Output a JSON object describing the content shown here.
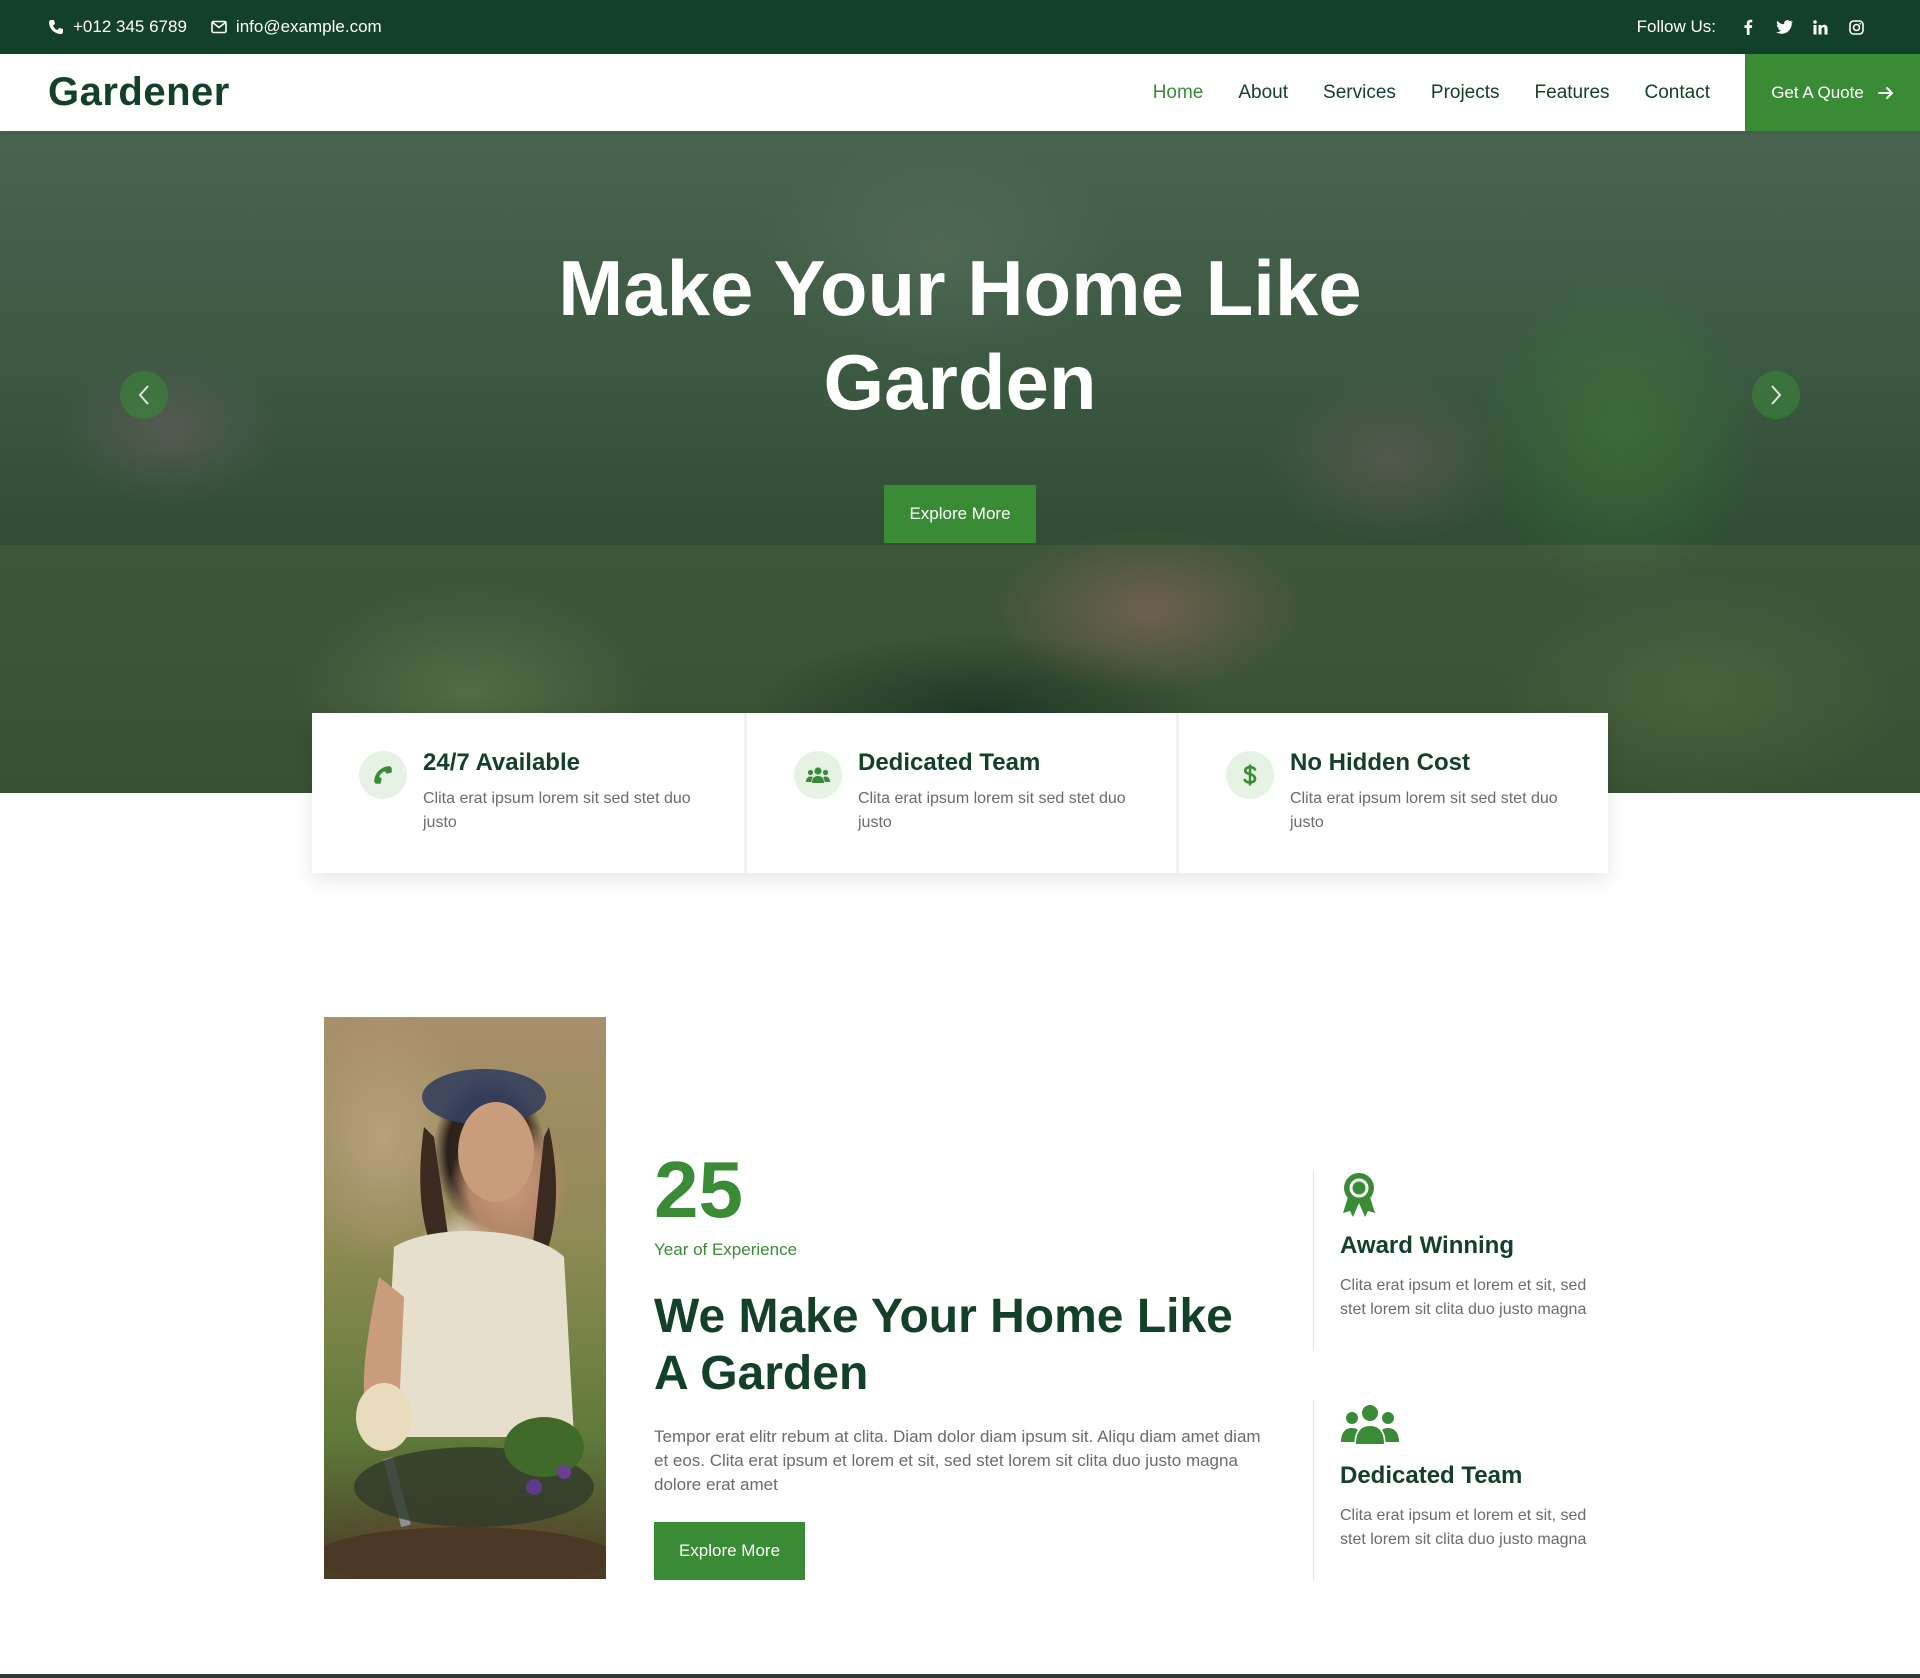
{
  "topbar": {
    "phone": "+012 345 6789",
    "email": "info@example.com",
    "follow_label": "Follow Us:",
    "social": [
      {
        "icon": "facebook-icon",
        "glyph": "f"
      },
      {
        "icon": "twitter-icon",
        "glyph": "t"
      },
      {
        "icon": "linkedin-icon",
        "glyph": "in"
      },
      {
        "icon": "instagram-icon",
        "glyph": "ig"
      }
    ]
  },
  "nav": {
    "brand": "Gardener",
    "items": [
      {
        "label": "Home",
        "active": true
      },
      {
        "label": "About",
        "active": false
      },
      {
        "label": "Services",
        "active": false
      },
      {
        "label": "Projects",
        "active": false
      },
      {
        "label": "Features",
        "active": false
      },
      {
        "label": "Contact",
        "active": false
      }
    ],
    "cta_label": "Get A Quote"
  },
  "hero": {
    "title_line1": "Make Your Home Like",
    "title_line2": "Garden",
    "button_label": "Explore More"
  },
  "features": [
    {
      "icon": "phone-icon",
      "title": "24/7 Available",
      "description": "Clita erat ipsum lorem sit sed stet duo justo"
    },
    {
      "icon": "users-icon",
      "title": "Dedicated Team",
      "description": "Clita erat ipsum lorem sit sed stet duo justo"
    },
    {
      "icon": "dollar-icon",
      "title": "No Hidden Cost",
      "description": "Clita erat ipsum lorem sit sed stet duo justo"
    }
  ],
  "about": {
    "years": "25",
    "years_label": "Year of Experience",
    "title": "We Make Your Home Like A Garden",
    "text": "Tempor erat elitr rebum at clita. Diam dolor diam ipsum sit. Aliqu diam amet diam et eos. Clita erat ipsum et lorem et sit, sed stet lorem sit clita duo justo magna dolore erat amet",
    "button_label": "Explore More",
    "side": [
      {
        "icon": "award-icon",
        "title": "Award Winning",
        "description": "Clita erat ipsum et lorem et sit, sed stet lorem sit clita duo justo magna"
      },
      {
        "icon": "team-icon",
        "title": "Dedicated Team",
        "description": "Clita erat ipsum et lorem et sit, sed stet lorem sit clita duo justo magna"
      }
    ]
  },
  "colors": {
    "primary_dark": "#134029",
    "accent_green": "#3a8b36",
    "text_gray": "#6b6b6b",
    "icon_bg": "#e6f2e4"
  }
}
